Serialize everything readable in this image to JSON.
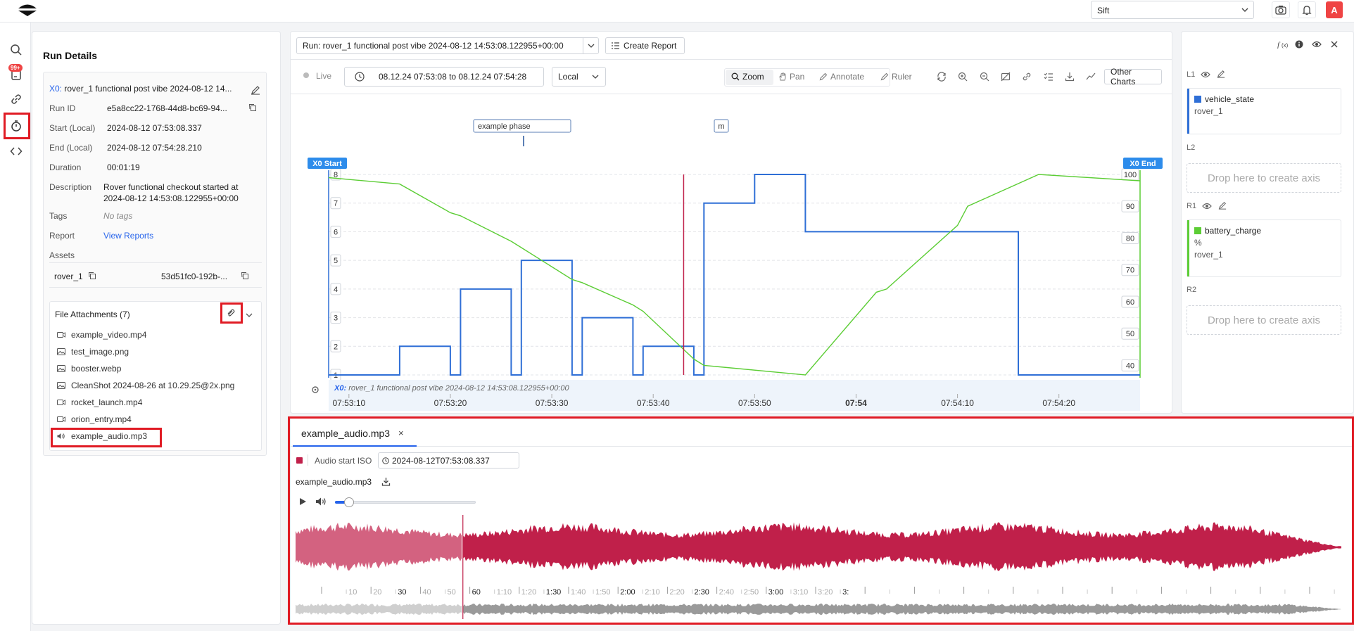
{
  "topbar": {
    "org": "Sift",
    "avatar": "A",
    "icons": [
      "camera-icon",
      "bell-icon"
    ]
  },
  "nav": {
    "badge": "99+",
    "items": [
      "search-icon",
      "annotations-icon",
      "link-icon",
      "stopwatch-icon",
      "code-icon"
    ]
  },
  "run_details": {
    "title": "Run Details",
    "run_prefix": "X0:",
    "run_name": "rover_1 functional post vibe 2024-08-12 14...",
    "fields": [
      {
        "label": "Run ID",
        "value": "e5a8cc22-1768-44d8-bc69-94..."
      },
      {
        "label": "Start (Local)",
        "value": "2024-08-12 07:53:08.337"
      },
      {
        "label": "End (Local)",
        "value": "2024-08-12 07:54:28.210"
      },
      {
        "label": "Duration",
        "value": "00:01:19"
      }
    ],
    "description_label": "Description",
    "description_line1": "Rover functional checkout started at",
    "description_line2": "2024-08-12 14:53:08.122955+00:00",
    "tags_label": "Tags",
    "tags_value": "No tags",
    "report_label": "Report",
    "report_link": "View Reports",
    "assets_label": "Assets",
    "asset_name": "rover_1",
    "asset_id": "53d51fc0-192b-..."
  },
  "attachments": {
    "title": "File Attachments (7)",
    "files": [
      {
        "name": "example_video.mp4",
        "icon": "video-icon"
      },
      {
        "name": "test_image.png",
        "icon": "image-icon"
      },
      {
        "name": "booster.webp",
        "icon": "image-icon"
      },
      {
        "name": "CleanShot 2024-08-26 at 10.29.25@2x.png",
        "icon": "image-icon"
      },
      {
        "name": "rocket_launch.mp4",
        "icon": "video-icon"
      },
      {
        "name": "orion_entry.mp4",
        "icon": "video-icon"
      },
      {
        "name": "example_audio.mp3",
        "icon": "speaker-icon"
      }
    ]
  },
  "toolbar": {
    "run_select": "Run: rover_1 functional post vibe 2024-08-12 14:53:08.122955+00:00",
    "create_report": "Create Report",
    "live": "Live",
    "time_range": "08.12.24 07:53:08 to 08.12.24 07:54:28",
    "timezone": "Local",
    "zoom": "Zoom",
    "pan": "Pan",
    "annotate": "Annotate",
    "ruler": "Ruler",
    "other_charts": "Other Charts"
  },
  "chart_data": {
    "type": "line",
    "annotations": [
      "example phase",
      "m"
    ],
    "markers": {
      "start": "X0 Start",
      "end": "X0 End"
    },
    "run_label_prefix": "X0:",
    "run_label": "rover_1 functional post vibe 2024-08-12 14:53:08.122955+00:00",
    "x_ticks": [
      "07:53:10",
      "07:53:20",
      "07:53:30",
      "07:53:40",
      "07:53:50",
      "07:54",
      "07:54:10",
      "07:54:20"
    ],
    "y_left": {
      "ticks": [
        1,
        2,
        3,
        4,
        5,
        6,
        7,
        8
      ],
      "ylim": [
        1,
        8
      ]
    },
    "y_right": {
      "ticks": [
        40,
        50,
        60,
        70,
        80,
        90,
        100
      ],
      "ylim": [
        37,
        100
      ]
    },
    "series": [
      {
        "name": "vehicle_state",
        "axis": "L1",
        "color": "#2f6fd6",
        "step": true,
        "points": [
          [
            0,
            1
          ],
          [
            7,
            1
          ],
          [
            7,
            2
          ],
          [
            12,
            2
          ],
          [
            12,
            1
          ],
          [
            13,
            1
          ],
          [
            13,
            4
          ],
          [
            18,
            4
          ],
          [
            18,
            1
          ],
          [
            19,
            1
          ],
          [
            19,
            5
          ],
          [
            24,
            5
          ],
          [
            24,
            1
          ],
          [
            25,
            1
          ],
          [
            25,
            3
          ],
          [
            30,
            3
          ],
          [
            30,
            1
          ],
          [
            31,
            1
          ],
          [
            31,
            2
          ],
          [
            36,
            2
          ],
          [
            36,
            1
          ],
          [
            37,
            1
          ],
          [
            37,
            7
          ],
          [
            42,
            7
          ],
          [
            42,
            8
          ],
          [
            47,
            8
          ],
          [
            47,
            6
          ],
          [
            68,
            6
          ],
          [
            68,
            1
          ],
          [
            80,
            1
          ]
        ]
      },
      {
        "name": "battery_charge",
        "axis": "R1",
        "color": "#5ccd35",
        "step": false,
        "points": [
          [
            0,
            99
          ],
          [
            7,
            97
          ],
          [
            12,
            88
          ],
          [
            13,
            87
          ],
          [
            18,
            79
          ],
          [
            19,
            77
          ],
          [
            24,
            67
          ],
          [
            25,
            66
          ],
          [
            30,
            59
          ],
          [
            31,
            57
          ],
          [
            36,
            42
          ],
          [
            37,
            40
          ],
          [
            47,
            37
          ],
          [
            54,
            63
          ],
          [
            55,
            64
          ],
          [
            62,
            84
          ],
          [
            63,
            90
          ],
          [
            70,
            100
          ],
          [
            80,
            98
          ]
        ]
      }
    ],
    "cursor_t": 35
  },
  "right_panel": {
    "l1": "L1",
    "l2": "L2",
    "r1": "R1",
    "r2": "R2",
    "l1_channel": "vehicle_state",
    "l1_asset": "rover_1",
    "r1_channel": "battery_charge",
    "r1_unit": "%",
    "r1_asset": "rover_1",
    "drop_text": "Drop here to create axis",
    "colors": {
      "vehicle_state": "#2f6fd6",
      "battery_charge": "#5ccd35"
    }
  },
  "audio": {
    "tab_name": "example_audio.mp3",
    "tab_close": "×",
    "start_label": "Audio start ISO",
    "start_value": "2024-08-12T07:53:08.337",
    "file_label": "example_audio.mp3",
    "timeline_labels": [
      "10",
      "20",
      "30",
      "40",
      "50",
      "60",
      "1:10",
      "1:20",
      "1:30",
      "1:40",
      "1:50",
      "2:00",
      "2:10",
      "2:20",
      "2:30",
      "2:40",
      "2:50",
      "3:00",
      "3:10",
      "3:20",
      "3:"
    ],
    "progress": 0.16,
    "volume": 0.1,
    "waveform_color": "#c0204a"
  }
}
